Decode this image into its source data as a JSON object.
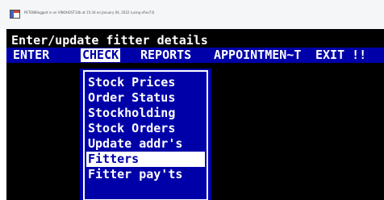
{
  "window": {
    "title": "PETENBlogged in on VINOHOST10b at 15:34 on January 04, 2022 (using eFee73)"
  },
  "header": {
    "text": "Enter/update fitter details"
  },
  "menu": {
    "items": [
      {
        "label": "ENTER",
        "active": false
      },
      {
        "label": "CHECK",
        "active": true
      },
      {
        "label": "REPORTS",
        "active": false
      },
      {
        "label": "APPOINTMEN~T",
        "active": false
      },
      {
        "label": "EXIT !!",
        "active": false
      }
    ]
  },
  "dropdown": {
    "items": [
      {
        "label": "Stock Prices",
        "selected": false
      },
      {
        "label": "Order Status",
        "selected": false
      },
      {
        "label": "Stockholding",
        "selected": false
      },
      {
        "label": "Stock Orders",
        "selected": false
      },
      {
        "label": "Update addr's",
        "selected": false
      },
      {
        "label": "Fitters",
        "selected": true
      },
      {
        "label": "Fitter pay'ts",
        "selected": false
      }
    ]
  },
  "colors": {
    "terminal_bg": "#000000",
    "menu_bg": "#0000a8",
    "text": "#ffffff",
    "highlight_bg": "#ffffff",
    "highlight_text": "#0000a8"
  }
}
